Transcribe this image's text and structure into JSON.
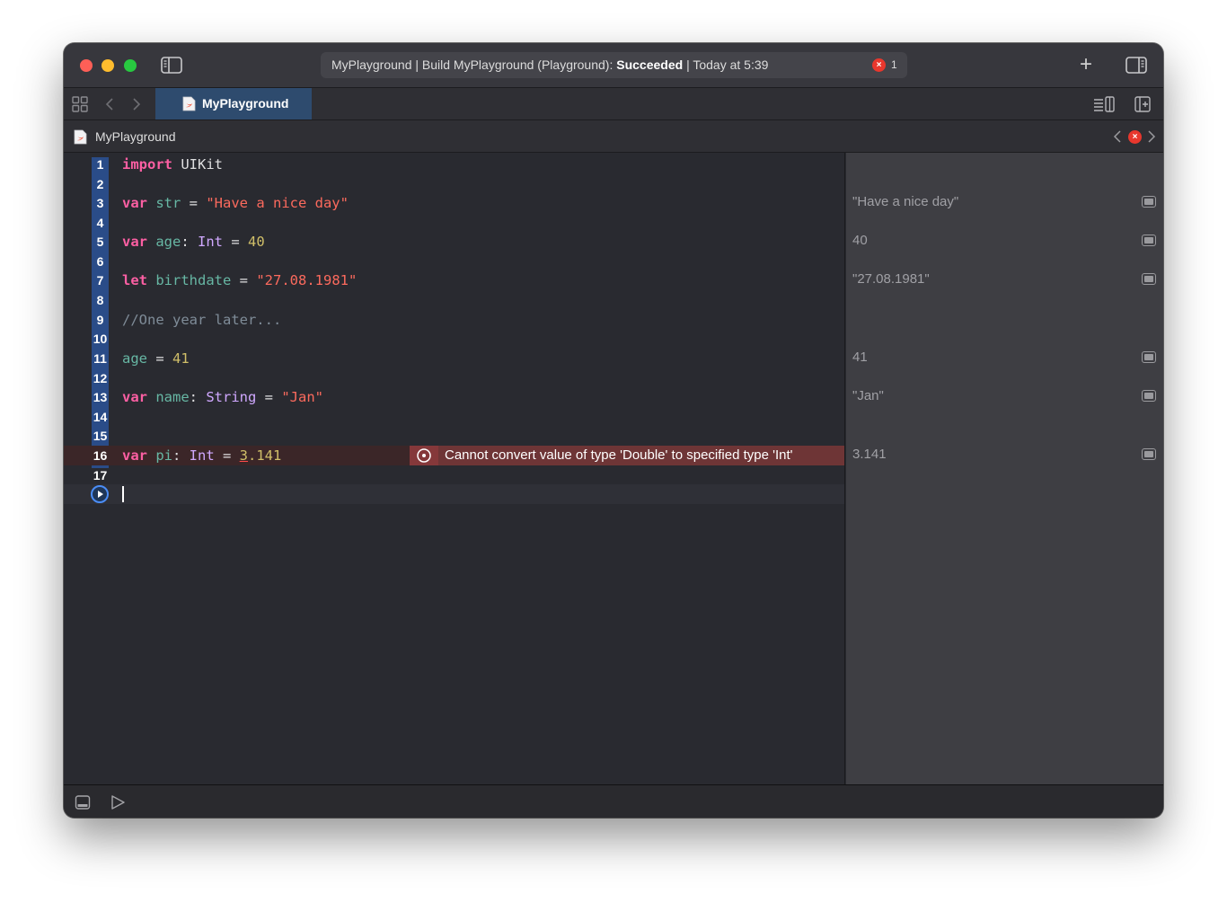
{
  "titlebar": {
    "activity_prefix": "MyPlayground | Build MyPlayground (Playground): ",
    "activity_status": "Succeeded",
    "activity_suffix": " | Today at 5:39",
    "error_count": "1"
  },
  "tab": {
    "label": "MyPlayground"
  },
  "jumpbar": {
    "crumb": "MyPlayground"
  },
  "editor": {
    "lines": [
      {
        "n": "1"
      },
      {
        "n": "2"
      },
      {
        "n": "3"
      },
      {
        "n": "4"
      },
      {
        "n": "5"
      },
      {
        "n": "6"
      },
      {
        "n": "7"
      },
      {
        "n": "8"
      },
      {
        "n": "9"
      },
      {
        "n": "10"
      },
      {
        "n": "11"
      },
      {
        "n": "12"
      },
      {
        "n": "13"
      },
      {
        "n": "14"
      },
      {
        "n": "15"
      },
      {
        "n": "16"
      },
      {
        "n": "17"
      }
    ],
    "code": {
      "l1": {
        "kw": "import",
        "rest": " UIKit"
      },
      "l3": {
        "kw": "var",
        "name": " str",
        "eq": " = ",
        "str": "\"Have a nice day\""
      },
      "l5": {
        "kw": "var",
        "name": " age",
        "colon": ": ",
        "type": "Int",
        "eq": " = ",
        "num": "40"
      },
      "l7": {
        "kw": "let",
        "name": " birthdate",
        "eq": " = ",
        "str": "\"27.08.1981\""
      },
      "l9": {
        "comment": "//One year later..."
      },
      "l11": {
        "name": "age",
        "eq": " = ",
        "num": "41"
      },
      "l13": {
        "kw": "var",
        "name": " name",
        "colon": ": ",
        "type": "String",
        "eq": " = ",
        "str": "\"Jan\""
      },
      "l16": {
        "kw": "var",
        "name": " pi",
        "colon": ": ",
        "type": "Int",
        "eq": " = ",
        "num_first": "3",
        "num_rest": ".141"
      }
    },
    "error_message": "Cannot convert value of type 'Double' to specified type 'Int'"
  },
  "results": {
    "r3": "\"Have a nice day\"",
    "r5": "40",
    "r7": "\"27.08.1981\"",
    "r11": "41",
    "r13": "\"Jan\"",
    "r16": "3.141"
  },
  "colors": {
    "keyword": "#fc5fa3",
    "string": "#fc6a5d",
    "number": "#d0bf69",
    "type": "#d0a8ff",
    "identifier": "#67b7a4",
    "comment": "#7f8c98",
    "error": "#e8372d"
  },
  "icons": {
    "window": [
      "close-icon",
      "minimize-icon",
      "zoom-icon",
      "sidebar-toggle-icon",
      "plus-icon",
      "inspector-toggle-icon"
    ],
    "tabbar": [
      "grid-icon",
      "chevron-left-icon",
      "chevron-right-icon",
      "swift-file-icon",
      "editor-options-icon",
      "add-editor-icon"
    ],
    "bottombar": [
      "debug-area-icon",
      "run-icon"
    ]
  }
}
